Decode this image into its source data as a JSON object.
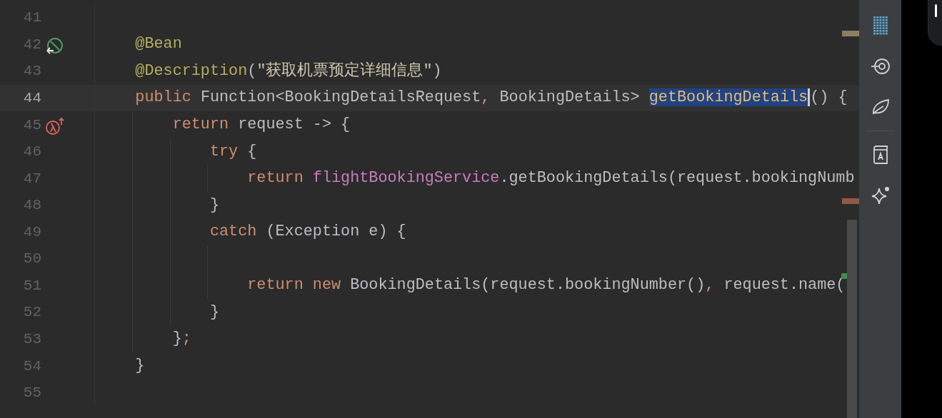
{
  "editor": {
    "lines": [
      {
        "number": "41",
        "current": false
      },
      {
        "number": "42",
        "current": false,
        "gutter_icon": {
          "kind": "bean"
        },
        "tokens": [
          {
            "text": "    @Bean",
            "kind": "annotation",
            "selected": false
          }
        ]
      },
      {
        "number": "43",
        "current": false,
        "tokens": [
          {
            "text": "    @Description",
            "kind": "annotation",
            "selected": false
          },
          {
            "text": "(",
            "kind": "plain",
            "selected": false
          },
          {
            "text": "\"获取机票预定详细信息\"",
            "kind": "string",
            "selected": false
          },
          {
            "text": ")",
            "kind": "plain",
            "selected": false
          }
        ]
      },
      {
        "number": "44",
        "current": true,
        "tokens": [
          {
            "text": "    public",
            "kind": "keyword",
            "selected": false
          },
          {
            "text": " Function<BookingDetailsRequest",
            "kind": "plain",
            "selected": false
          },
          {
            "text": ",",
            "kind": "keyword",
            "selected": false
          },
          {
            "text": " BookingDetails> ",
            "kind": "plain",
            "selected": false
          },
          {
            "text": "getBookingDetails",
            "kind": "method",
            "selected": true
          },
          {
            "text": "() {",
            "kind": "plain",
            "selected": false
          }
        ]
      },
      {
        "number": "45",
        "current": false,
        "gutter_icon": {
          "kind": "lambda"
        },
        "tokens": [
          {
            "text": "        return",
            "kind": "keyword",
            "selected": false
          },
          {
            "text": " request -> {",
            "kind": "plain",
            "selected": false
          }
        ]
      },
      {
        "number": "46",
        "current": false,
        "tokens": [
          {
            "text": "            try",
            "kind": "keyword",
            "selected": false
          },
          {
            "text": " {",
            "kind": "plain",
            "selected": false
          }
        ]
      },
      {
        "number": "47",
        "current": false,
        "tokens": [
          {
            "text": "                return",
            "kind": "keyword",
            "selected": false
          },
          {
            "text": " flightBookingService",
            "kind": "field",
            "selected": false
          },
          {
            "text": ".getBookingDetails(request.bookingNumb",
            "kind": "plain",
            "selected": false
          }
        ]
      },
      {
        "number": "48",
        "current": false,
        "tokens": [
          {
            "text": "            }",
            "kind": "plain",
            "selected": false
          }
        ]
      },
      {
        "number": "49",
        "current": false,
        "tokens": [
          {
            "text": "            catch",
            "kind": "keyword",
            "selected": false
          },
          {
            "text": " (Exception e) {",
            "kind": "plain",
            "selected": false
          }
        ]
      },
      {
        "number": "50",
        "current": false
      },
      {
        "number": "51",
        "current": false,
        "tokens": [
          {
            "text": "                return",
            "kind": "keyword",
            "selected": false
          },
          {
            "text": " new",
            "kind": "keyword",
            "selected": false
          },
          {
            "text": " BookingDetails(request.bookingNumber()",
            "kind": "plain",
            "selected": false
          },
          {
            "text": ",",
            "kind": "keyword",
            "selected": false
          },
          {
            "text": " request.name(",
            "kind": "plain",
            "selected": false
          }
        ]
      },
      {
        "number": "52",
        "current": false,
        "tokens": [
          {
            "text": "            }",
            "kind": "plain",
            "selected": false
          }
        ]
      },
      {
        "number": "53",
        "current": false,
        "tokens": [
          {
            "text": "        }",
            "kind": "plain",
            "selected": false
          },
          {
            "text": ";",
            "kind": "keyword",
            "selected": false
          }
        ]
      },
      {
        "number": "54",
        "current": false,
        "tokens": [
          {
            "text": "    }",
            "kind": "plain",
            "selected": false
          }
        ]
      },
      {
        "number": "55",
        "current": false
      }
    ]
  },
  "toolbar": [
    {
      "kind": "binary"
    },
    {
      "kind": "target"
    },
    {
      "kind": "leaf"
    },
    {
      "kind": "separator"
    },
    {
      "kind": "book"
    },
    {
      "kind": "sparkle"
    }
  ]
}
